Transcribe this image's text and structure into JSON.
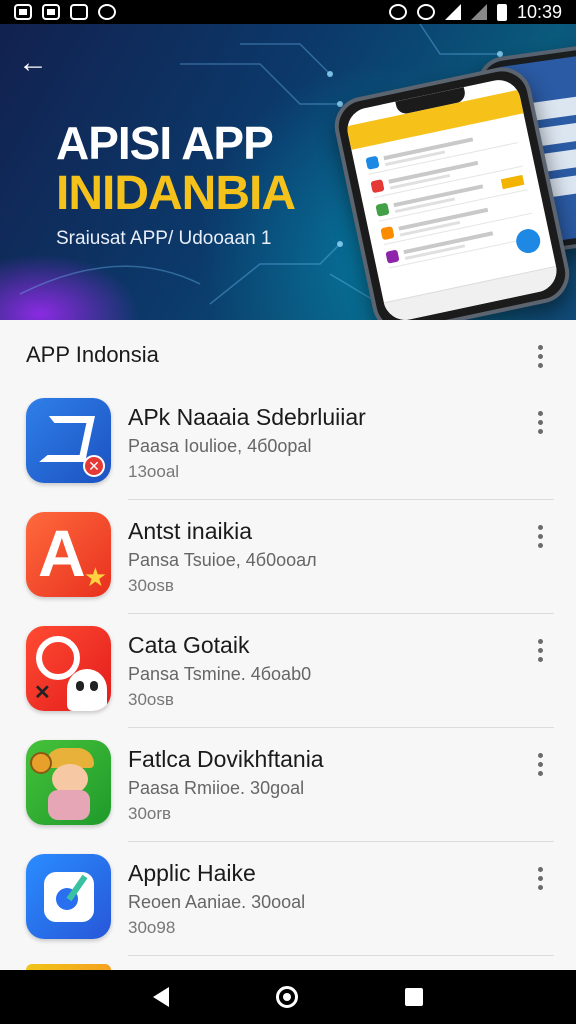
{
  "status_bar": {
    "time": "10:39",
    "left_icons": [
      "gallery-icon",
      "photo-icon",
      "app-icon",
      "sync-icon"
    ],
    "right_icons": [
      "alarm-icon",
      "alarm-icon",
      "wifi-icon",
      "signal-icon",
      "signal-icon",
      "battery-icon"
    ]
  },
  "hero": {
    "title_line1": "APISI APP",
    "title_line2": "INIDANBIA",
    "subtitle": "Sraiusat APP/ Udooaan 1",
    "accent_color": "#f5c21b"
  },
  "section": {
    "title": "APP Indonsia"
  },
  "apps": [
    {
      "name": "APk Naaaia Sdebrluiiar",
      "meta": "Paasa Ioulioe, 4б0opal",
      "size": "13ooal",
      "icon": "blue-flag-icon"
    },
    {
      "name": "Antst inaikia",
      "meta": "Pansa Tsuioe, 4б0ooaл",
      "size": "30osв",
      "icon": "red-a-icon"
    },
    {
      "name": "Cata Gotaik",
      "meta": "Pansa Tsmine. 4боab0",
      "size": "30osв",
      "icon": "ghost-icon"
    },
    {
      "name": "Fatlca Dovikhftania",
      "meta": "Paasa Rmiioe. 30goal",
      "size": "30orв",
      "icon": "character-icon"
    },
    {
      "name": "Applic Haike",
      "meta": "Reoen Aaniae. 30ooal",
      "size": "30o98",
      "icon": "map-pin-icon"
    }
  ]
}
